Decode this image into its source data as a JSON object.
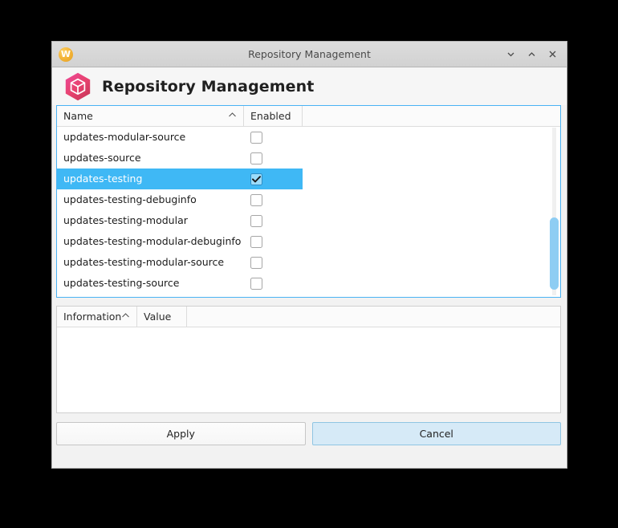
{
  "window": {
    "titlebar": {
      "app_icon": "w-logo-icon",
      "title": "Repository Management",
      "controls": [
        {
          "name": "minimize-button",
          "icon": "chevron-down-icon"
        },
        {
          "name": "maximize-button",
          "icon": "chevron-up-icon"
        },
        {
          "name": "close-button",
          "icon": "close-icon"
        }
      ]
    },
    "header": {
      "icon": "package-hexagon-icon",
      "title": "Repository Management"
    }
  },
  "repo_table": {
    "columns": [
      {
        "label": "Name",
        "sort_indicator": "caret-up-icon"
      },
      {
        "label": "Enabled"
      }
    ],
    "rows": [
      {
        "name": "updates-modular-source",
        "enabled": false,
        "selected": false
      },
      {
        "name": "updates-source",
        "enabled": false,
        "selected": false
      },
      {
        "name": "updates-testing",
        "enabled": true,
        "selected": true
      },
      {
        "name": "updates-testing-debuginfo",
        "enabled": false,
        "selected": false
      },
      {
        "name": "updates-testing-modular",
        "enabled": false,
        "selected": false
      },
      {
        "name": "updates-testing-modular-debuginfo",
        "enabled": false,
        "selected": false
      },
      {
        "name": "updates-testing-modular-source",
        "enabled": false,
        "selected": false
      },
      {
        "name": "updates-testing-source",
        "enabled": false,
        "selected": false
      }
    ]
  },
  "info_table": {
    "columns": [
      {
        "label": "Information",
        "sort_indicator": "caret-up-icon"
      },
      {
        "label": "Value"
      }
    ],
    "rows": []
  },
  "buttons": {
    "apply_label": "Apply",
    "cancel_label": "Cancel"
  },
  "colors": {
    "selection_blue": "#3fb8f5",
    "panel_focus_border": "#4ab3f4",
    "cancel_button_bg": "#d6eaf7",
    "app_icon_orange": "#f2b134",
    "header_icon_pink": "#e8437f",
    "scrollbar_thumb": "#8ecdf3"
  }
}
